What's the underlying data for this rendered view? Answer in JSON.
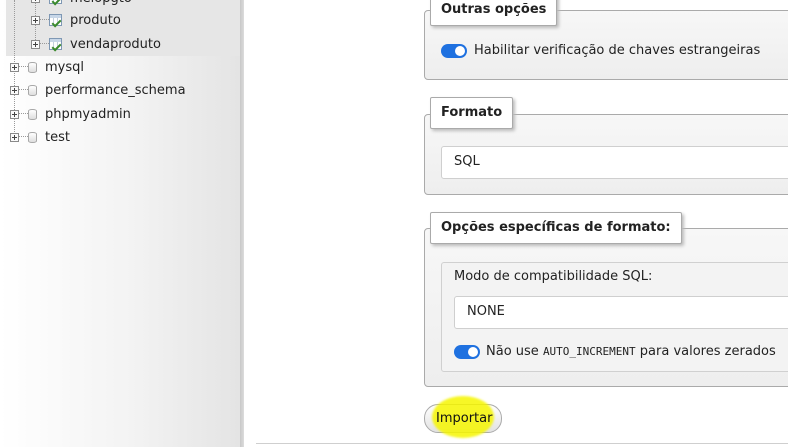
{
  "navigation": {
    "tables": [
      {
        "label": "meiopgto"
      },
      {
        "label": "produto"
      },
      {
        "label": "vendaproduto"
      }
    ],
    "databases": [
      {
        "label": "mysql"
      },
      {
        "label": "performance_schema"
      },
      {
        "label": "phpmyadmin"
      },
      {
        "label": "test"
      }
    ]
  },
  "import_form": {
    "other_options": {
      "legend": "Outras opções",
      "foreign_key_checks_label": "Habilitar verificação de chaves estrangeiras",
      "foreign_key_checks_enabled": true
    },
    "format": {
      "legend": "Formato",
      "selected": "SQL"
    },
    "format_specific": {
      "legend": "Opções específicas de formato:",
      "compat_label": "Modo de compatibilidade SQL:",
      "compat_selected": "NONE",
      "auto_increment_prefix": "Não use",
      "auto_increment_code": "AUTO_INCREMENT",
      "auto_increment_suffix": "para valores zerados",
      "auto_increment_enabled": true
    },
    "import_button_label": "Importar"
  },
  "colors": {
    "toggle_on": "#1f71e0",
    "highlight": "#f6f600"
  }
}
